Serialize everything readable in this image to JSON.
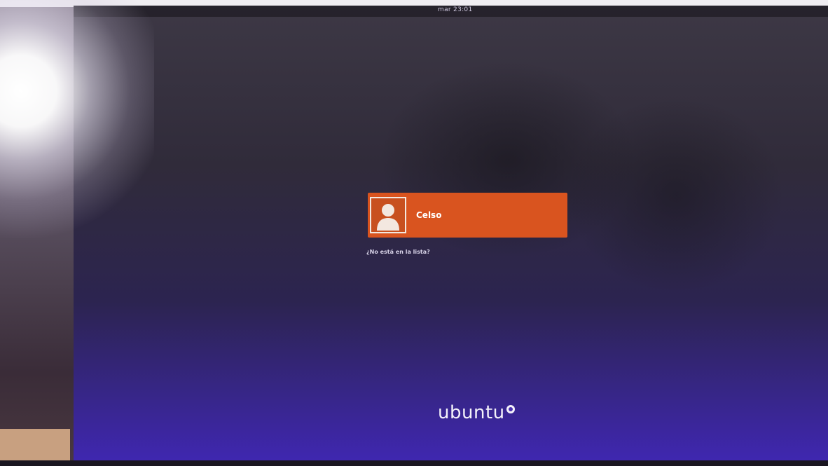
{
  "topbar": {
    "clock": "mar 23:01"
  },
  "login": {
    "users": [
      {
        "name": "Celso",
        "avatar_icon": "user-avatar-icon"
      }
    ],
    "not_listed_label": "¿No está en la lista?"
  },
  "branding": {
    "logo_text": "ubuntu",
    "logo_icon": "circle-of-friends-icon"
  },
  "colors": {
    "accent": "#d9541f",
    "background_bottom": "#3f27b0"
  }
}
